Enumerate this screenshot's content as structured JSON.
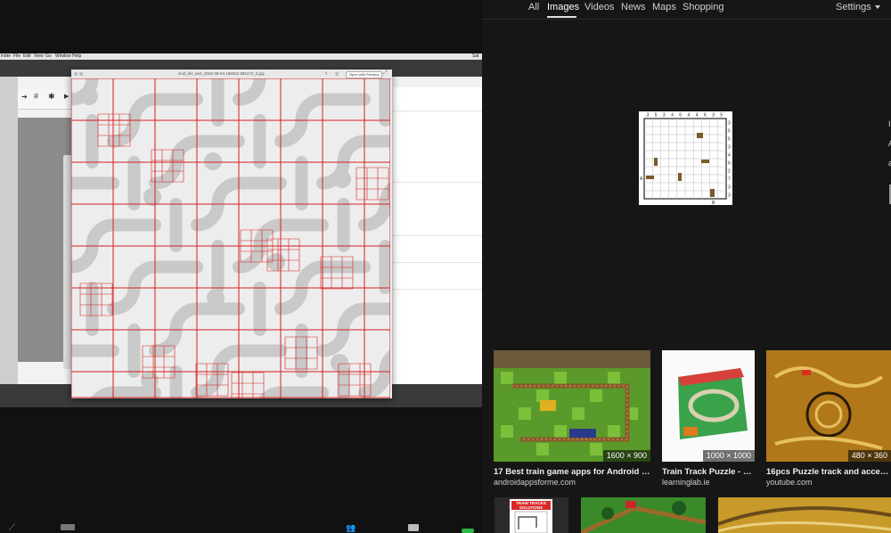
{
  "mac": {
    "menu": [
      "inder",
      "File",
      "Edit",
      "View",
      "Go",
      "Window",
      "Help"
    ],
    "clock": "Sat",
    "preview_title": "snirt_tile_test_2020-06-04 165022 891174_2.jpg",
    "open_with_preview": "Open with Preview"
  },
  "search": {
    "tabs": [
      "All",
      "Images",
      "Videos",
      "News",
      "Maps",
      "Shopping"
    ],
    "active_tab": "Images",
    "settings_label": "Settings",
    "preview": {
      "top_numbers": [
        "3",
        "5",
        "3",
        "4",
        "6",
        "4",
        "4",
        "6",
        "3",
        "5"
      ],
      "right_numbers": [
        "3",
        "5",
        "5",
        "3",
        "4",
        "6",
        "2",
        "7",
        "3",
        "3"
      ],
      "label_a": "A",
      "label_b": "B"
    },
    "side_letters": [
      "I",
      "A",
      "a",
      "1"
    ],
    "results": [
      {
        "dims": "1600 × 900",
        "title": "17 Best train game apps for Android | An...",
        "source": "androidappsforme.com"
      },
      {
        "dims": "1000 × 1000",
        "title": "Train Track Puzzle - Th...",
        "source": "learninglab.ie"
      },
      {
        "dims": "480 × 360",
        "title": "16pcs Puzzle track and accessori...",
        "source": "youtube.com"
      }
    ],
    "row2": [
      {
        "label": "TRAIN TRACKS SOLUTIONS"
      }
    ]
  },
  "colors": {
    "accent_green": "#2fb344",
    "grid_red": "#d81e1e"
  }
}
